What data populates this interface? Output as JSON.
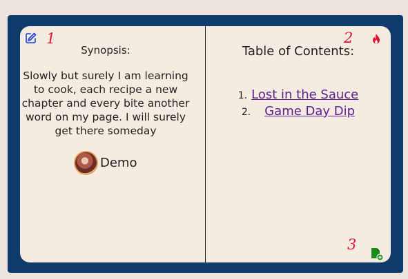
{
  "left_page": {
    "marker": "1",
    "synopsis_title": "Synopsis:",
    "synopsis_text": "Slowly but surely I am learning to cook, each recipe a new chapter and every bite another word on my page. I will surely get there someday",
    "author_name": "Demo",
    "edit_icon": "edit-icon"
  },
  "right_page": {
    "marker": "2",
    "toc_title": "Table of Contents:",
    "chapters": [
      {
        "number": "1.",
        "title": "Lost in the Sauce"
      },
      {
        "number": "2.",
        "title": "Game Day Dip"
      }
    ],
    "fire_icon": "fire-icon",
    "bottom_marker": "3",
    "add_icon": "add-file-icon"
  },
  "colors": {
    "frame": "#0f3b6c",
    "page": "#f4ebe1",
    "link": "#5b1e8f",
    "marker": "#e0142e",
    "fire": "#e0142e",
    "add": "#1a8c1a",
    "edit": "#1a3fd6"
  }
}
